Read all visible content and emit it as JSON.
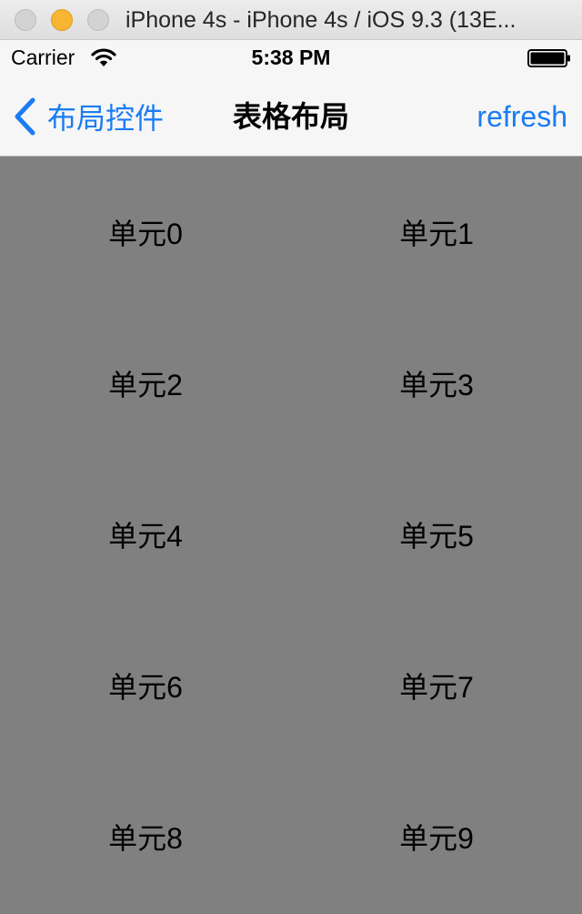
{
  "window": {
    "title": "iPhone 4s - iPhone 4s / iOS 9.3 (13E..."
  },
  "status_bar": {
    "carrier": "Carrier",
    "time": "5:38 PM",
    "icons": [
      "wifi-icon",
      "battery-icon"
    ]
  },
  "nav_bar": {
    "back_label": "布局控件",
    "title": "表格布局",
    "right_button": "refresh"
  },
  "cells": [
    "单元0",
    "单元1",
    "单元2",
    "单元3",
    "单元4",
    "单元5",
    "单元6",
    "单元7",
    "单元8",
    "单元9"
  ],
  "colors": {
    "accent": "#1b7cf3",
    "content_background": "#808080",
    "bar_background": "#f6f6f6"
  }
}
